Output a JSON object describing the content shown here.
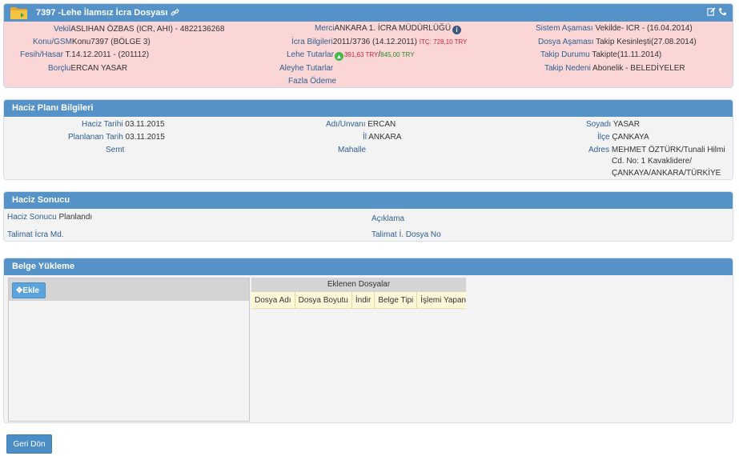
{
  "case": {
    "title": "7397 -Lehe İlamsız İcra Dosyası",
    "vekil_label": "Vekil",
    "vekil_value": "ASLIHAN ÖZBAS (ICR, AHI) - 4822136268",
    "konu_label": "Konu/GSM",
    "konu_value": "Konu7397 (BÖLGE 3)",
    "fesih_label": "Fesih/Hasar",
    "fesih_value": "T.14.12.2011 - (201112)",
    "borclu_label": "Borçlu",
    "borclu_value": "ERCAN YASAR",
    "merci_label": "Merci",
    "merci_value": "ANKARA 1. İCRA MÜDÜRLÜĞÜ",
    "icra_label": "İcra Bilgileri",
    "icra_value": "2011/3736 (14.12.2011)",
    "itc_value": "İTÇ: 728,10 TRY",
    "lehe_label": "Lehe Tutarlar",
    "lehe_value1": "391,63 TRY",
    "lehe_sep": "/",
    "lehe_value2": "845,00 TRY",
    "aleyhe_label": "Aleyhe Tutarlar",
    "fazla_label": "Fazla Ödeme",
    "sistem_label": "Sistem Aşaması",
    "sistem_value": "Vekilde- ICR - (16.04.2014)",
    "dosya_label": "Dosya Aşaması",
    "dosya_value": "Takip Kesinleşti(27.08.2014)",
    "takip_label": "Takip Durumu",
    "takip_value": "Takipte(11.11.2014)",
    "neden_label": "Takip Nedeni",
    "neden_value": "Abonelik - BELEDİYELER"
  },
  "plan": {
    "heading": "Haciz Planı Bilgileri",
    "tarih_label": "Haciz Tarihi",
    "tarih_value": "03.11.2015",
    "planlanan_label": "Planlanan Tarih",
    "planlanan_value": "03.11.2015",
    "semt_label": "Semt",
    "adi_label": "Adı/Unvanı",
    "adi_value": "ERCAN",
    "il_label": "İl",
    "il_value": "ANKARA",
    "mahalle_label": "Mahalle",
    "soyadi_label": "Soyadı",
    "soyadi_value": "YASAR",
    "ilce_label": "İlçe",
    "ilce_value": "ÇANKAYA",
    "adres_label": "Adres",
    "adres_line1": "MEHMET  ÖZTÜRK/Tunali Hilmi",
    "adres_line2": "Cd. No: 1 Kavaklidere/",
    "adres_line3": "ÇANKAYA/ANKARA/TÜRKİYE"
  },
  "result": {
    "heading": "Haciz Sonucu",
    "sonuc_label": "Haciz Sonucu",
    "sonuc_value": "Planlandı",
    "talimat_label": "Talimat İcra Md.",
    "aciklama_label": "Açıklama",
    "talimat_dosya_label": "Talimat İ. Dosya No"
  },
  "upload": {
    "heading": "Belge Yükleme",
    "add_label": "Ekle",
    "files_caption": "Eklenen Dosyalar",
    "columns": [
      "Dosya Adı",
      "Dosya Boyutu",
      "İndir",
      "Belge Tipi",
      "İşlemi Yapan"
    ]
  },
  "footer": {
    "back_label": "Geri Dön"
  },
  "colors": {
    "header_blue": "#5592c8",
    "case_bg": "#fbd6d6",
    "label_blue": "#2e5f8f"
  }
}
